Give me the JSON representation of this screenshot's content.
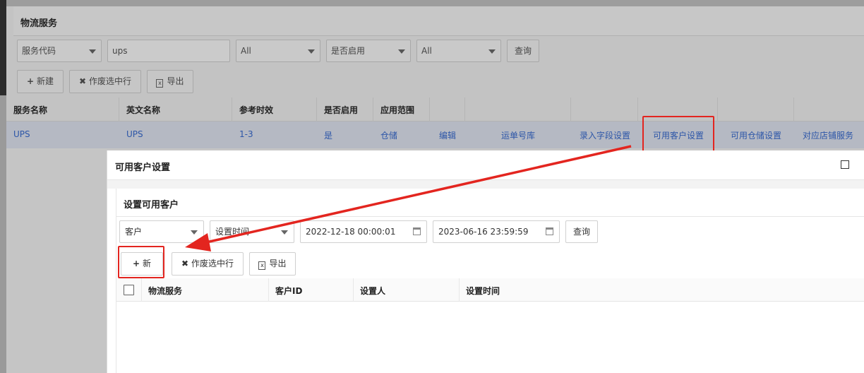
{
  "background": {
    "page_title": "物流服务",
    "filters": {
      "field_select": "服务代码",
      "keyword": "ups",
      "select1": "All",
      "enabled_select": "是否启用",
      "select3": "All",
      "query_label": "查询"
    },
    "toolbar": {
      "new_label": "新建",
      "void_label": "作废选中行",
      "export_label": "导出"
    },
    "table": {
      "headers": [
        "服务名称",
        "英文名称",
        "参考时效",
        "是否启用",
        "应用范围"
      ],
      "row": {
        "name": "UPS",
        "english_name": "UPS",
        "time": "1-3",
        "enabled": "是",
        "scope": "仓储",
        "actions": [
          "编辑",
          "运单号库",
          "录入字段设置",
          "可用客户设置",
          "可用仓储设置",
          "对应店铺服务"
        ]
      }
    }
  },
  "modal": {
    "title": "可用客户设置",
    "section_title": "设置可用客户",
    "filters": {
      "customer_select": "客户",
      "time_select": "设置时间",
      "start_date": "2022-12-18 00:00:01",
      "end_date": "2023-06-16 23:59:59",
      "query_label": "查询"
    },
    "toolbar": {
      "new_label": "新建",
      "void_label": "作废选中行",
      "export_label": "导出"
    },
    "grid_headers": [
      "物流服务",
      "客户ID",
      "设置人",
      "设置时间"
    ]
  },
  "colors": {
    "annotation_red": "#e3251f",
    "link_blue": "#2d56a8"
  }
}
